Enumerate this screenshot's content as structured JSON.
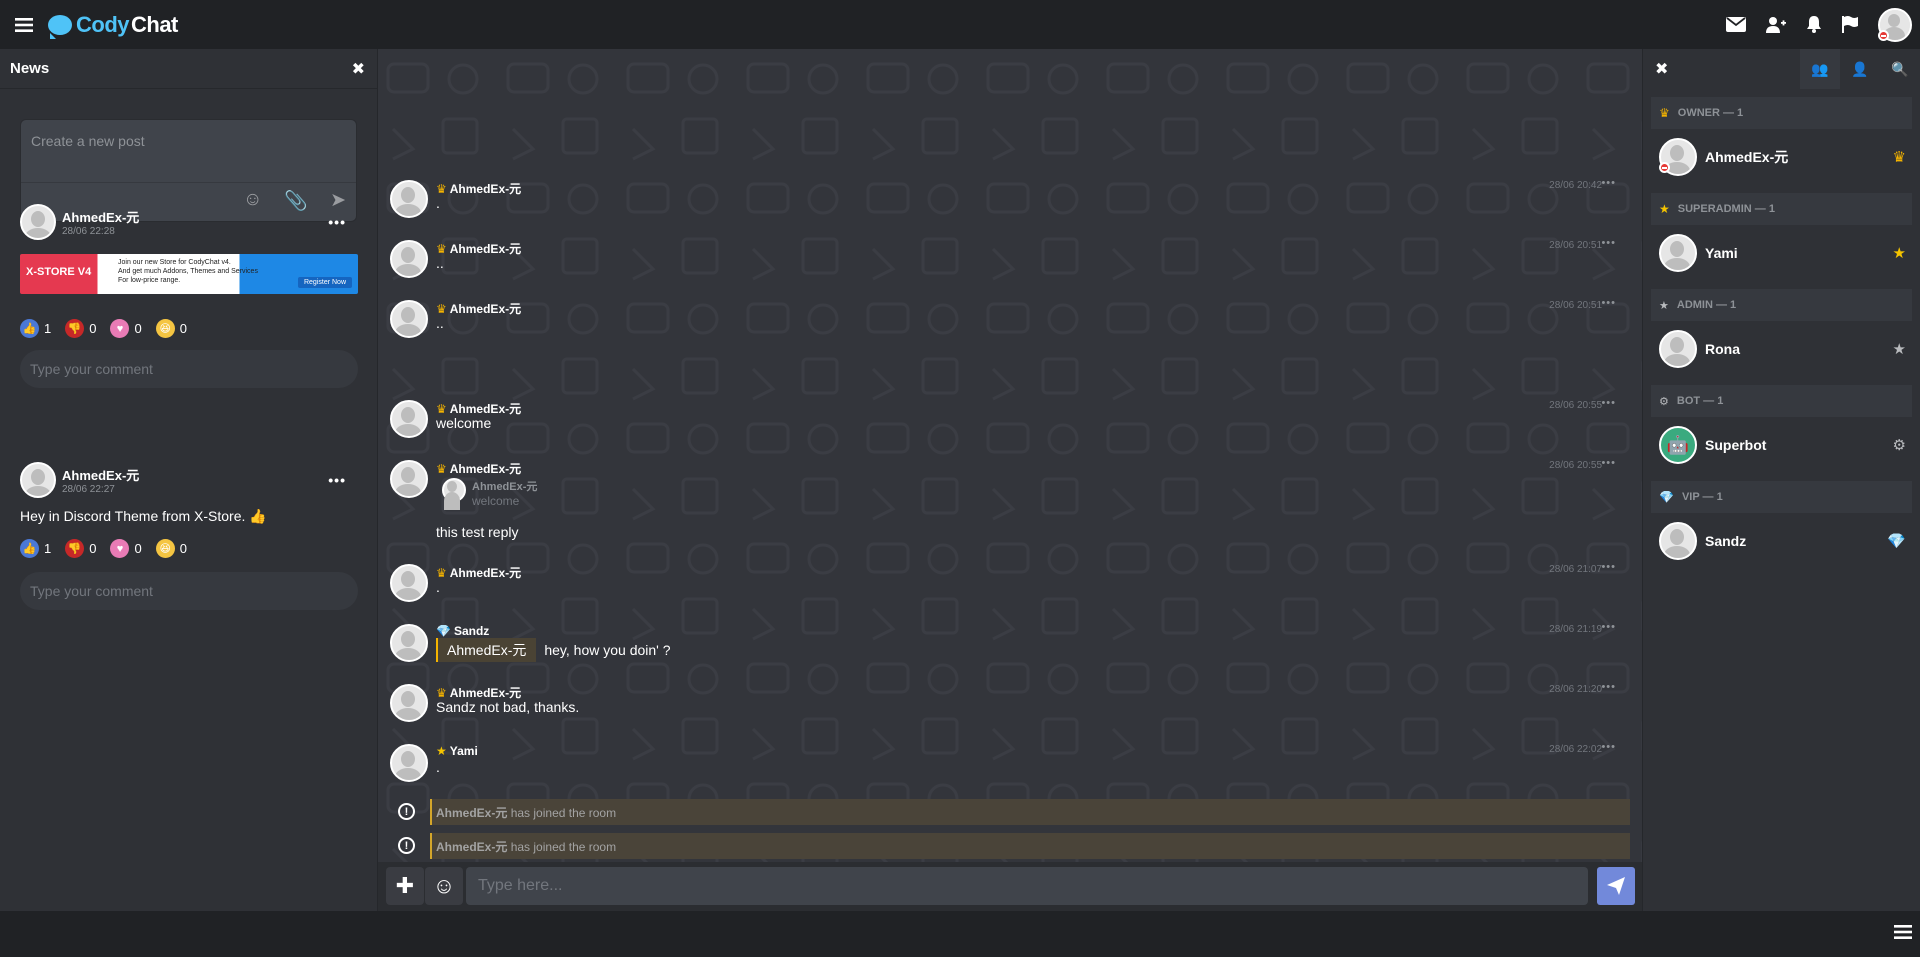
{
  "app": {
    "logo_part1": "Cody",
    "logo_part2": "Chat"
  },
  "colors": {
    "accent": "#7289da",
    "logo": "#4fc3f7",
    "owner": "#f5b400",
    "notice": "#d4a62a"
  },
  "topbar": {
    "icons": [
      "menu-icon",
      "envelope-icon",
      "add-friend-icon",
      "bell-icon",
      "flag-icon"
    ]
  },
  "news": {
    "title": "News",
    "composer_placeholder": "Create a new post",
    "posts": [
      {
        "author": "AhmedEx-元",
        "date": "28/06 22:28",
        "banner": {
          "brand": "X-STORE V4",
          "line1": "Join our new Store for CodyChat v4.",
          "line2": "And get much Addons, Themes and Services",
          "line3": "For low-price range.",
          "button": "Register Now"
        },
        "reactions": {
          "like": "1",
          "dislike": "0",
          "love": "0",
          "funny": "0"
        },
        "comment_placeholder": "Type your comment"
      },
      {
        "author": "AhmedEx-元",
        "date": "28/06 22:27",
        "text": "Hey in Discord Theme from X-Store. 👍",
        "reactions": {
          "like": "1",
          "dislike": "0",
          "love": "0",
          "funny": "0"
        },
        "comment_placeholder": "Type your comment"
      }
    ]
  },
  "chat": {
    "messages": [
      {
        "user": "AhmedEx-元",
        "rank": "crown",
        "text": ".",
        "time": "28/06 20:42"
      },
      {
        "user": "AhmedEx-元",
        "rank": "crown",
        "text": "..",
        "time": "28/06 20:51"
      },
      {
        "user": "AhmedEx-元",
        "rank": "crown",
        "text": "..",
        "time": "28/06 20:51"
      },
      {
        "user": "AhmedEx-元",
        "rank": "crown",
        "text": "welcome",
        "time": "28/06 20:55"
      },
      {
        "user": "AhmedEx-元",
        "rank": "crown",
        "reply_user": "AhmedEx-元",
        "reply_text": "welcome",
        "text": "this test reply",
        "time": "28/06 20:55"
      },
      {
        "user": "AhmedEx-元",
        "rank": "crown",
        "text": ".",
        "time": "28/06 21:07"
      },
      {
        "user": "Sandz",
        "rank": "gem",
        "mention": "AhmedEx-元",
        "text": "hey, how you doin' ?",
        "time": "28/06 21:19"
      },
      {
        "user": "AhmedEx-元",
        "rank": "crown",
        "text": "Sandz not bad, thanks.",
        "time": "28/06 21:20"
      },
      {
        "user": "Yami",
        "rank": "star",
        "text": ".",
        "time": "28/06 22:02"
      }
    ],
    "notices": [
      {
        "user": "AhmedEx-元",
        "text": "has joined the room"
      },
      {
        "user": "AhmedEx-元",
        "text": "has joined the room"
      }
    ],
    "input_placeholder": "Type here..."
  },
  "users_panel": {
    "groups": [
      {
        "label": "OWNER — 1",
        "icon": "crown-icon",
        "users": [
          {
            "name": "AhmedEx-元",
            "badge": "crown-icon"
          }
        ]
      },
      {
        "label": "SUPERADMIN — 1",
        "icon": "star-icon",
        "users": [
          {
            "name": "Yami",
            "badge": "star-icon"
          }
        ]
      },
      {
        "label": "ADMIN — 1",
        "icon": "star-icon",
        "users": [
          {
            "name": "Rona",
            "badge": "star-icon"
          }
        ]
      },
      {
        "label": "BOT — 1",
        "icon": "robot-icon",
        "users": [
          {
            "name": "Superbot",
            "badge": "robot-icon"
          }
        ]
      },
      {
        "label": "VIP — 1",
        "icon": "gem-icon",
        "users": [
          {
            "name": "Sandz",
            "badge": "gem-icon"
          }
        ]
      }
    ]
  }
}
